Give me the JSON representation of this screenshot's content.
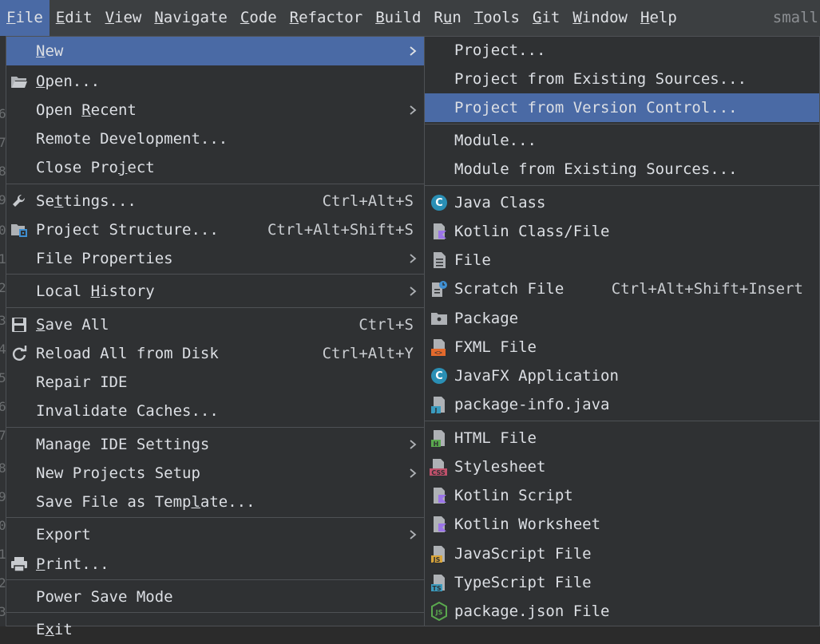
{
  "menubar": {
    "items": [
      {
        "mn": "F",
        "rest": "ile"
      },
      {
        "mn": "E",
        "rest": "dit"
      },
      {
        "mn": "V",
        "rest": "iew"
      },
      {
        "mn": "N",
        "rest": "avigate"
      },
      {
        "mn": "C",
        "rest": "ode"
      },
      {
        "mn": "R",
        "rest": "efactor"
      },
      {
        "mn": "B",
        "rest": "uild"
      },
      {
        "pre": "R",
        "mn": "u",
        "rest": "n"
      },
      {
        "mn": "T",
        "rest": "ools"
      },
      {
        "mn": "G",
        "rest": "it"
      },
      {
        "mn": "W",
        "rest": "indow"
      },
      {
        "mn": "H",
        "rest": "elp"
      }
    ],
    "project_name": "small"
  },
  "gutter_digits": [
    "6",
    "7",
    "8",
    "9",
    "0",
    "1",
    "2",
    "3",
    "4",
    "5",
    "6",
    "7",
    "8",
    "9",
    "0",
    "1",
    "2",
    "3",
    "4"
  ],
  "file_menu": {
    "new": {
      "pre": "",
      "mn": "N",
      "rest": "ew"
    },
    "open": {
      "pre": "",
      "mn": "O",
      "rest": "pen..."
    },
    "open_recent": {
      "pre": "Open ",
      "mn": "R",
      "rest": "ecent"
    },
    "remote_dev": "Remote Development...",
    "close_project": {
      "pre": "Close Pro",
      "mn": "j",
      "rest": "ect"
    },
    "settings": {
      "pre": "Se",
      "mn": "t",
      "rest": "tings..."
    },
    "settings_shortcut": "Ctrl+Alt+S",
    "project_structure": "Project Structure...",
    "project_structure_shortcut": "Ctrl+Alt+Shift+S",
    "file_properties": "File Properties",
    "local_history": {
      "pre": "Local ",
      "mn": "H",
      "rest": "istory"
    },
    "save_all": {
      "pre": "",
      "mn": "S",
      "rest": "ave All"
    },
    "save_all_shortcut": "Ctrl+S",
    "reload": "Reload All from Disk",
    "reload_shortcut": "Ctrl+Alt+Y",
    "repair": "Repair IDE",
    "invalidate": "Invalidate Caches...",
    "manage_settings": "Manage IDE Settings",
    "new_projects_setup": "New Projects Setup",
    "save_template": {
      "pre": "Save File as Temp",
      "mn": "l",
      "rest": "ate..."
    },
    "export": "Export",
    "print": {
      "pre": "",
      "mn": "P",
      "rest": "rint..."
    },
    "power_save": "Power Save Mode",
    "exit": {
      "pre": "E",
      "mn": "x",
      "rest": "it"
    }
  },
  "new_menu": {
    "project": "Project...",
    "project_existing": "Project from Existing Sources...",
    "project_vcs": "Project from Version Control...",
    "module": "Module...",
    "module_existing": "Module from Existing Sources...",
    "java_class": "Java Class",
    "kotlin_class": "Kotlin Class/File",
    "file": "File",
    "scratch": "Scratch File",
    "scratch_shortcut": "Ctrl+Alt+Shift+Insert",
    "package": "Package",
    "fxml": "FXML File",
    "javafx": "JavaFX Application",
    "package_info": "package-info.java",
    "html": "HTML File",
    "stylesheet": "Stylesheet",
    "kotlin_script": "Kotlin Script",
    "kotlin_worksheet": "Kotlin Worksheet",
    "js_file": "JavaScript File",
    "ts_file": "TypeScript File",
    "package_json": "package.json File"
  },
  "icon_text": {
    "class_c": "C",
    "fxml_tag": "<>",
    "java_j": "J",
    "html_h": "H",
    "css": "CSS",
    "js": "JS",
    "ts": "TS",
    "node_js": "JS"
  },
  "colors": {
    "selection": "#4a6aa5",
    "menu_bg": "#2f3133",
    "menubar_bg": "#3c3f41",
    "text": "#dcdfe4"
  }
}
